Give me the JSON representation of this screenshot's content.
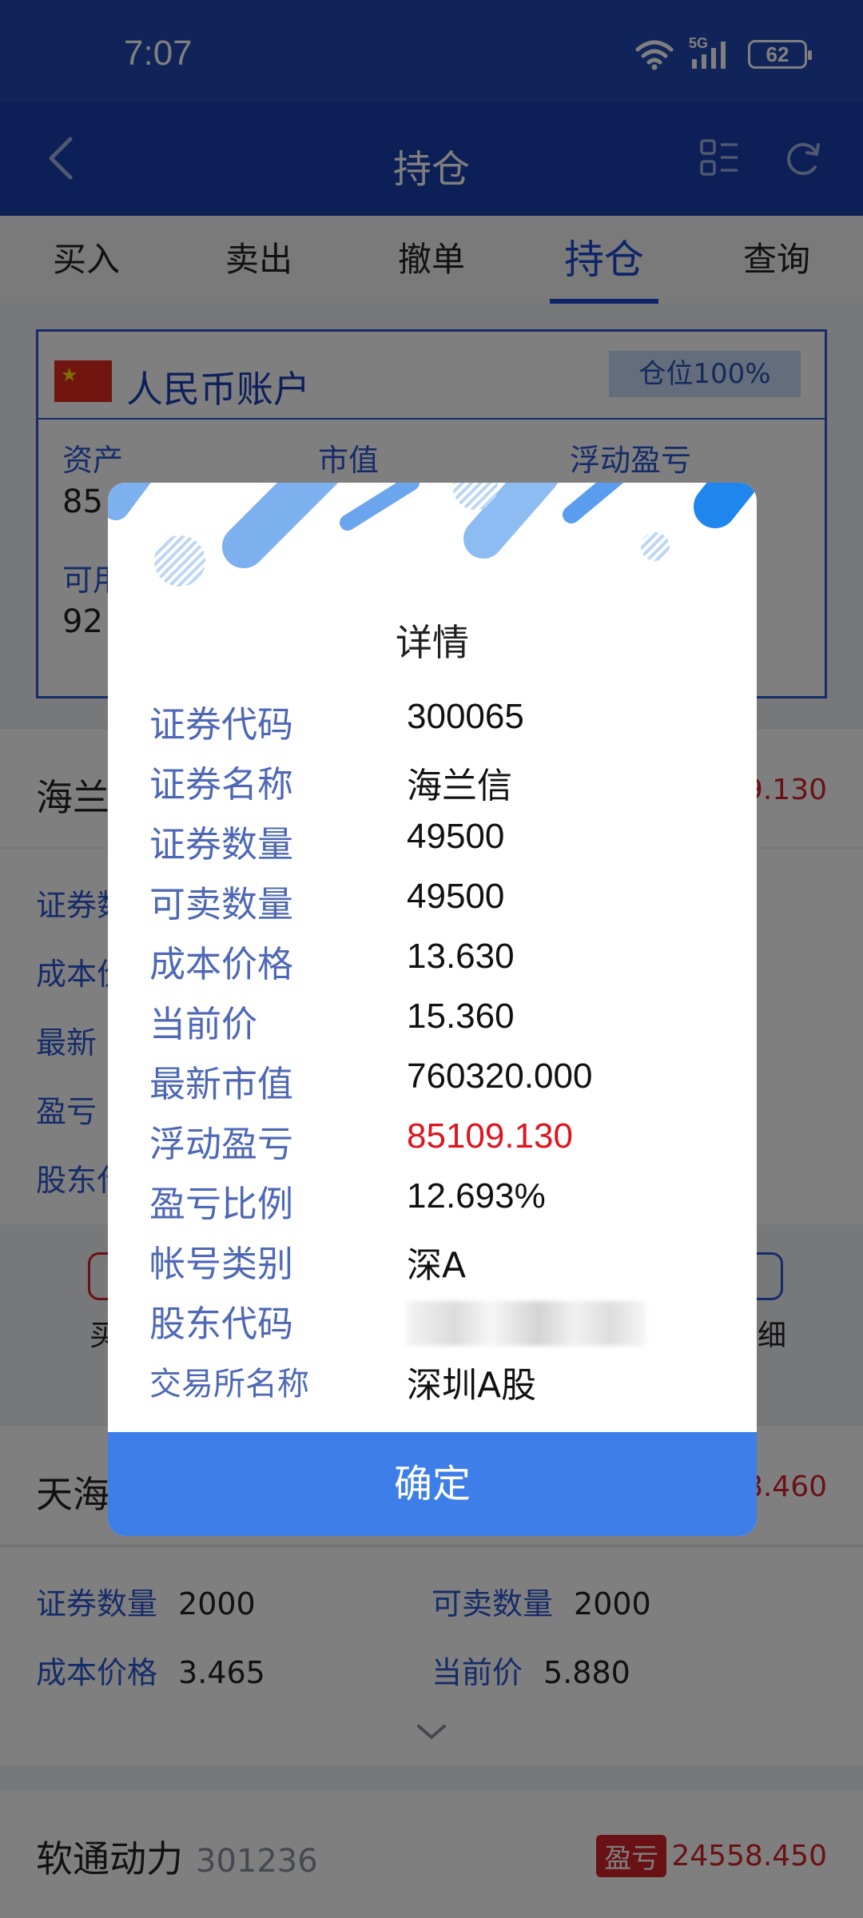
{
  "status": {
    "time": "7:07",
    "network": "5G",
    "battery": "62"
  },
  "nav": {
    "title": "持仓"
  },
  "tabs": [
    {
      "label": "买入"
    },
    {
      "label": "卖出"
    },
    {
      "label": "撤单"
    },
    {
      "label": "持仓",
      "active": true
    },
    {
      "label": "查询"
    }
  ],
  "account": {
    "title": "人民币账户",
    "position_badge": "仓位100%",
    "labels": {
      "assets": "资产",
      "market_value": "市值",
      "floating_pl": "浮动盈亏",
      "available": "可用"
    },
    "values": {
      "assets_partial": "85",
      "available_partial": "92"
    }
  },
  "holdings": [
    {
      "name_partial": "海兰",
      "pl_partial": "9.130"
    },
    {
      "name_partial": "天海",
      "pl_partial": "8.460",
      "details": {
        "qty_label": "证券数量",
        "qty": "2000",
        "sellable_label": "可卖数量",
        "sellable": "2000",
        "cost_label": "成本价格",
        "cost": "3.465",
        "price_label": "当前价",
        "price": "5.880"
      }
    },
    {
      "name": "软通动力",
      "code": "301236",
      "pl_badge": "盈亏",
      "pl": "24558.450"
    }
  ],
  "background_side_labels": {
    "left": [
      "证券数",
      "成本价",
      "最新",
      "盈亏",
      "股东代"
    ],
    "action_left": "买",
    "action_right": "细"
  },
  "modal": {
    "title": "详情",
    "rows": [
      {
        "label": "证券代码",
        "value": "300065"
      },
      {
        "label": "证券名称",
        "value": "海兰信"
      },
      {
        "label": "证券数量",
        "value": "49500"
      },
      {
        "label": "可卖数量",
        "value": "49500"
      },
      {
        "label": "成本价格",
        "value": "13.630"
      },
      {
        "label": "当前价",
        "value": "15.360"
      },
      {
        "label": "最新市值",
        "value": "760320.000"
      },
      {
        "label": "浮动盈亏",
        "value": "85109.130"
      },
      {
        "label": "盈亏比例",
        "value": "12.693%"
      },
      {
        "label": "帐号类别",
        "value": "深A"
      },
      {
        "label": "股东代码",
        "value": ""
      },
      {
        "label": "交易所名称",
        "value": "深圳A股"
      }
    ],
    "ok_label": "确定"
  },
  "colors": {
    "header": "#1b3fae",
    "accent": "#3d7ee8",
    "loss_red": "#e0141e"
  }
}
